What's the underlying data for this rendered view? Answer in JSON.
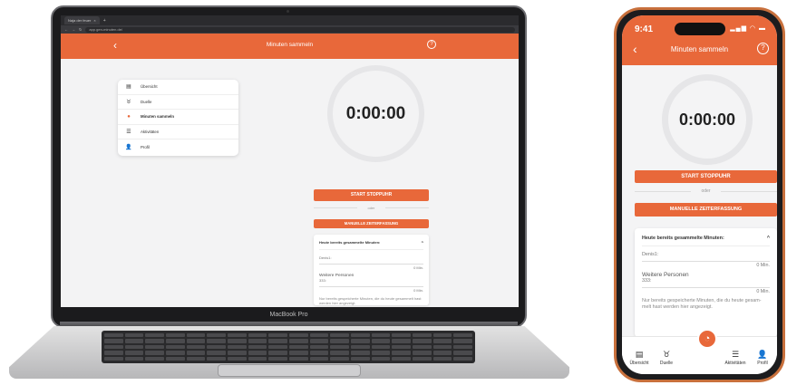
{
  "browser": {
    "tab_title": "Naja der feuer",
    "url": "app.gen-minuten.de/",
    "close_glyph": "×",
    "new_tab_glyph": "+"
  },
  "app": {
    "title": "Minuten sammeln",
    "timer": "0:00:00",
    "start_label": "START STOPPUHR",
    "or_label": "oder",
    "manual_label": "MANUELLE ZEITERFASSUNG",
    "back_glyph": "‹",
    "help_glyph": "?"
  },
  "menu": [
    {
      "label": "Übersicht",
      "icon": "overview-icon",
      "glyph": "▤"
    },
    {
      "label": "Duelle",
      "icon": "medal-icon",
      "glyph": "♉"
    },
    {
      "label": "Minuten sammeln",
      "icon": "stopwatch-icon",
      "glyph": "●"
    },
    {
      "label": "Aktivitäten",
      "icon": "activities-icon",
      "glyph": "☰"
    },
    {
      "label": "Profil",
      "icon": "profile-icon",
      "glyph": "👤"
    }
  ],
  "laptop_card": {
    "title": "Heute bereits gesammelte Minuten:",
    "chevron": "^",
    "row1_label": "Denis1:",
    "row1_value": "0 Min.",
    "section_label": "Weitere Personen",
    "row2_label": "333:",
    "row2_value": "0 Min.",
    "note": "Nur bereits gespeicherte Minuten, die du heute gesammelt hast werden hier angezeigt."
  },
  "laptop_brand": "MacBook Pro",
  "phone": {
    "status_time": "9:41",
    "status_icons": "▂▄▆ ◠ ▬"
  },
  "phone_card": {
    "title": "Heute bereits gesammelte Minuten:",
    "chevron": "^",
    "row1_label": "Denis1:",
    "row1_value": "0 Min.",
    "section_label": "Weitere Personen",
    "row2_label": "333:",
    "row2_value": "0 Min.",
    "note": "Nur bereits gespeicherte Minuten, die du heute gesam-melt hast werden hier angezeigt."
  },
  "phone_tabs": [
    {
      "label": "Übersicht",
      "icon": "overview-icon",
      "glyph": "▤"
    },
    {
      "label": "Duelle",
      "icon": "medal-icon",
      "glyph": "♉"
    },
    {
      "label": "Aktivitäten",
      "icon": "activities-icon",
      "glyph": "☰"
    },
    {
      "label": "Profil",
      "icon": "profile-icon",
      "glyph": "👤"
    }
  ],
  "fab_glyph": "◔",
  "colors": {
    "accent": "#e8683a",
    "text": "#333333",
    "background": "#f3f3f4"
  }
}
